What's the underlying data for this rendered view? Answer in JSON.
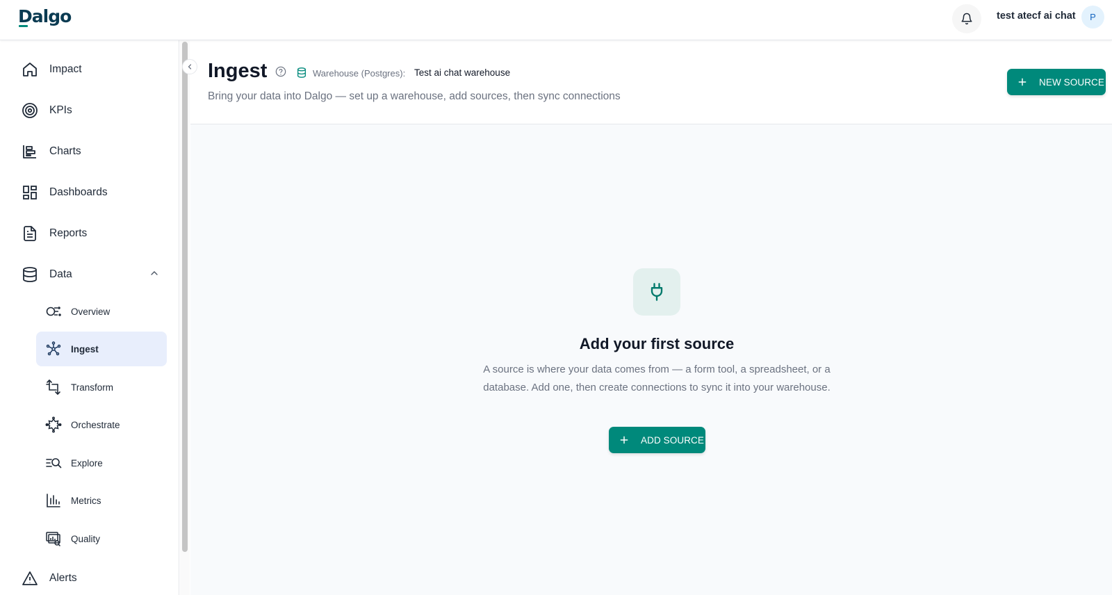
{
  "app": {
    "logo": "Dalgo"
  },
  "topbar": {
    "user_name": "test atecf ai chat",
    "avatar_initial": "P",
    "bell_icon": "bell-icon"
  },
  "sidebar": {
    "items": [
      {
        "label": "Impact",
        "icon": "home-icon"
      },
      {
        "label": "KPIs",
        "icon": "target-icon"
      },
      {
        "label": "Charts",
        "icon": "bar-chart-icon"
      },
      {
        "label": "Dashboards",
        "icon": "dashboard-icon"
      },
      {
        "label": "Reports",
        "icon": "report-icon"
      },
      {
        "label": "Data",
        "icon": "database-icon",
        "expanded": true
      },
      {
        "label": "Alerts",
        "icon": "warning-icon"
      }
    ],
    "data_subitems": [
      {
        "label": "Overview",
        "icon": "overview-icon"
      },
      {
        "label": "Ingest",
        "icon": "ingest-icon",
        "active": true
      },
      {
        "label": "Transform",
        "icon": "transform-icon"
      },
      {
        "label": "Orchestrate",
        "icon": "orchestrate-icon"
      },
      {
        "label": "Explore",
        "icon": "explore-icon"
      },
      {
        "label": "Metrics",
        "icon": "metrics-icon"
      },
      {
        "label": "Quality",
        "icon": "quality-icon"
      }
    ]
  },
  "header": {
    "title": "Ingest",
    "warehouse_label": "Warehouse (Postgres):",
    "warehouse_name": "Test ai chat warehouse",
    "subtitle": "Bring your data into Dalgo — set up a warehouse, add sources, then sync connections",
    "new_source_label": "NEW SOURCE"
  },
  "empty_state": {
    "icon": "plug-icon",
    "title": "Add your first source",
    "description": "A source is where your data comes from — a form tool, a spreadsheet, or a database. Add one, then create connections to sync it into your warehouse.",
    "button_label": "ADD SOURCE"
  },
  "colors": {
    "primary": "#00897b",
    "active_bg": "#e8eefc",
    "logo": "#0b3b52"
  }
}
